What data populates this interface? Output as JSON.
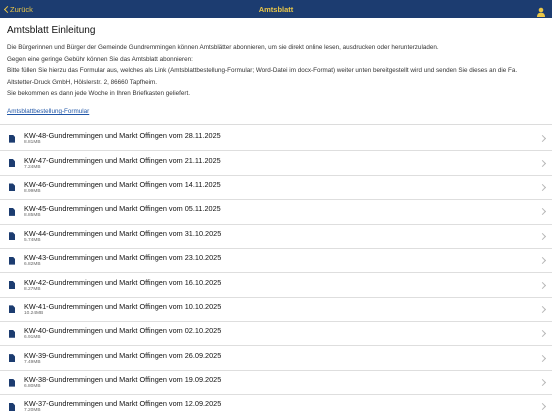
{
  "navbar": {
    "back_label": "Zurück",
    "title": "Amtsblatt"
  },
  "intro": {
    "heading": "Amtsblatt Einleitung",
    "lines": [
      "Die Bürgerinnen und Bürger der Gemeinde Gundremmingen können Amtsblätter abonnieren, um sie direkt online lesen, ausdrucken oder herunterzuladen.",
      "Gegen eine geringe Gebühr können Sie das Amtsblatt abonnieren:",
      "Bitte füllen Sie hierzu das Formular aus, welches als Link (Amtsblattbestellung-Formular; Word-Datei im docx-Format) weiter unten bereitgestellt wird und senden Sie dieses an die Fa.",
      "Altstetter-Druck GmbH, Hölslerstr. 2, 86660 Tapfheim.",
      "Sie bekommen es dann jede Woche in Ihren Briefkasten geliefert."
    ],
    "link_label": "Amtsblattbestellung-Formular"
  },
  "documents": [
    {
      "title": "KW-48-Gundremmingen und Markt Offingen vom 28.11.2025",
      "size": "8.81MB"
    },
    {
      "title": "KW-47-Gundremmingen und Markt Offingen vom 21.11.2025",
      "size": "7.24MB"
    },
    {
      "title": "KW-46-Gundremmingen und Markt Offingen vom 14.11.2025",
      "size": "8.99MB"
    },
    {
      "title": "KW-45-Gundremmingen und Markt Offingen vom 05.11.2025",
      "size": "8.85MB"
    },
    {
      "title": "KW-44-Gundremmingen und Markt Offingen vom 31.10.2025",
      "size": "5.74MB"
    },
    {
      "title": "KW-43-Gundremmingen und Markt Offingen vom 23.10.2025",
      "size": "6.82MB"
    },
    {
      "title": "KW-42-Gundremmingen und Markt Offingen vom 16.10.2025",
      "size": "8.27MB"
    },
    {
      "title": "KW-41-Gundremmingen und Markt Offingen vom 10.10.2025",
      "size": "10.24MB"
    },
    {
      "title": "KW-40-Gundremmingen und Markt Offingen vom 02.10.2025",
      "size": "6.91MB"
    },
    {
      "title": "KW-39-Gundremmingen und Markt Offingen vom 26.09.2025",
      "size": "7.49MB"
    },
    {
      "title": "KW-38-Gundremmingen und Markt Offingen vom 19.09.2025",
      "size": "6.80MB"
    },
    {
      "title": "KW-37-Gundremmingen und Markt Offingen vom 12.09.2025",
      "size": "7.20MB"
    }
  ],
  "icons": {
    "back": "chevron-left-icon",
    "user": "user-icon",
    "document": "document-icon",
    "row_arrow": "chevron-right-icon"
  },
  "colors": {
    "navbar_bg": "#1c3c70",
    "navbar_accent": "#e9c648",
    "link": "#1f55a7",
    "doc_icon": "#1c3c70"
  }
}
